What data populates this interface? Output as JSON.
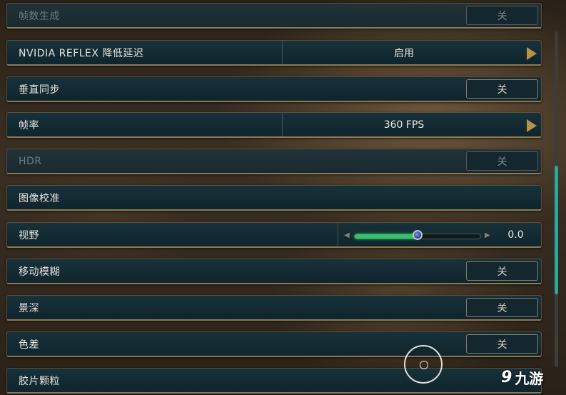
{
  "settings": [
    {
      "label": "帧数生成",
      "value": "关",
      "disabled": true
    },
    {
      "label": "NVIDIA REFLEX 降低延迟",
      "value": "启用"
    },
    {
      "label": "垂直同步",
      "value": "关"
    },
    {
      "label": "帧率",
      "value": "360 FPS"
    },
    {
      "label": "HDR",
      "value": "关",
      "disabled": true
    },
    {
      "label": "图像校准"
    },
    {
      "label": "视野",
      "value": "0.0",
      "level": 0.5
    },
    {
      "label": "移动模糊",
      "value": "关"
    },
    {
      "label": "景深",
      "value": "关"
    },
    {
      "label": "色差",
      "value": "关"
    },
    {
      "label": "胶片颗粒"
    }
  ],
  "watermark": {
    "text": "九游",
    "logo": "9"
  },
  "colors": {
    "accent": "#2fc46a",
    "row_bg": "#17313a",
    "border": "#8b7a55",
    "arrow": "#b9924a"
  }
}
